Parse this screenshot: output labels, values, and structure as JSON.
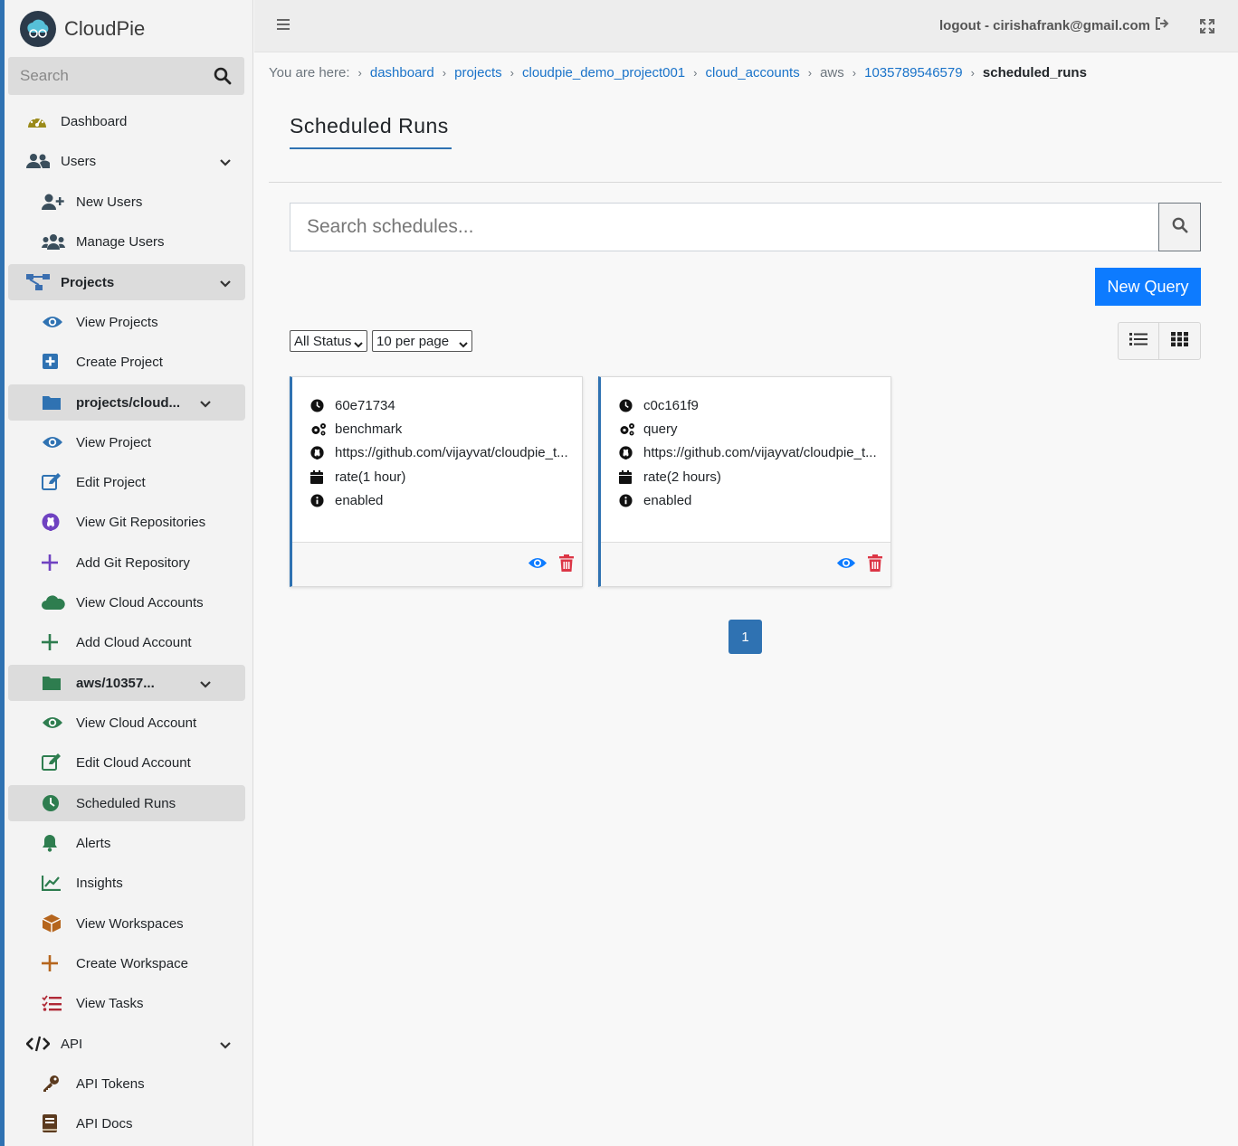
{
  "brand": {
    "name": "CloudPie"
  },
  "sidebar": {
    "search_placeholder": "Search",
    "items": [
      {
        "label": "Dashboard",
        "icon": "dashboard-icon"
      },
      {
        "label": "Users",
        "icon": "users-icon"
      },
      {
        "label": "New Users",
        "icon": "user-plus-icon"
      },
      {
        "label": "Manage Users",
        "icon": "users-cog-icon"
      },
      {
        "label": "Projects",
        "icon": "project-diagram-icon"
      },
      {
        "label": "View Projects",
        "icon": "eye-icon"
      },
      {
        "label": "Create Project",
        "icon": "plus-square-icon"
      },
      {
        "label": "projects/cloud...",
        "icon": "folder-icon"
      },
      {
        "label": "View Project",
        "icon": "eye-icon"
      },
      {
        "label": "Edit Project",
        "icon": "edit-icon"
      },
      {
        "label": "View Git Repositories",
        "icon": "github-icon"
      },
      {
        "label": "Add Git Repository",
        "icon": "plus-icon"
      },
      {
        "label": "View Cloud Accounts",
        "icon": "cloud-icon"
      },
      {
        "label": "Add Cloud Account",
        "icon": "plus-icon"
      },
      {
        "label": "aws/10357...",
        "icon": "folder-icon"
      },
      {
        "label": "View Cloud Account",
        "icon": "eye-icon"
      },
      {
        "label": "Edit Cloud Account",
        "icon": "edit-icon"
      },
      {
        "label": "Scheduled Runs",
        "icon": "clock-icon"
      },
      {
        "label": "Alerts",
        "icon": "bell-icon"
      },
      {
        "label": "Insights",
        "icon": "chart-line-icon"
      },
      {
        "label": "View Workspaces",
        "icon": "box-icon"
      },
      {
        "label": "Create Workspace",
        "icon": "plus-icon"
      },
      {
        "label": "View Tasks",
        "icon": "tasks-icon"
      },
      {
        "label": "API",
        "icon": "code-icon"
      },
      {
        "label": "API Tokens",
        "icon": "key-icon"
      },
      {
        "label": "API Docs",
        "icon": "book-icon"
      }
    ]
  },
  "topbar": {
    "logout_label": "logout - cirishafrank@gmail.com"
  },
  "breadcrumb": {
    "prefix": "You are here:",
    "links": [
      "dashboard",
      "projects",
      "cloudpie_demo_project001",
      "cloud_accounts",
      "aws",
      "1035789546579"
    ],
    "current": "scheduled_runs"
  },
  "page": {
    "title": "Scheduled Runs",
    "search_placeholder": "Search schedules...",
    "new_query_label": "New Query",
    "status_filter": "All Status",
    "per_page": "10 per page",
    "current_page": "1"
  },
  "schedules": [
    {
      "id": "60e71734",
      "type": "benchmark",
      "repo": "https://github.com/vijayvat/cloudpie_t...",
      "rate": "rate(1 hour)",
      "status": "enabled"
    },
    {
      "id": "c0c161f9",
      "type": "query",
      "repo": "https://github.com/vijayvat/cloudpie_t...",
      "rate": "rate(2 hours)",
      "status": "enabled"
    }
  ],
  "colors": {
    "accent": "#2f72b2",
    "primary_button": "#0d7bff",
    "link": "#1a73c9",
    "danger": "#dc3545",
    "sidebar_green": "#2e7d4f",
    "gold": "#9a8a1a"
  }
}
